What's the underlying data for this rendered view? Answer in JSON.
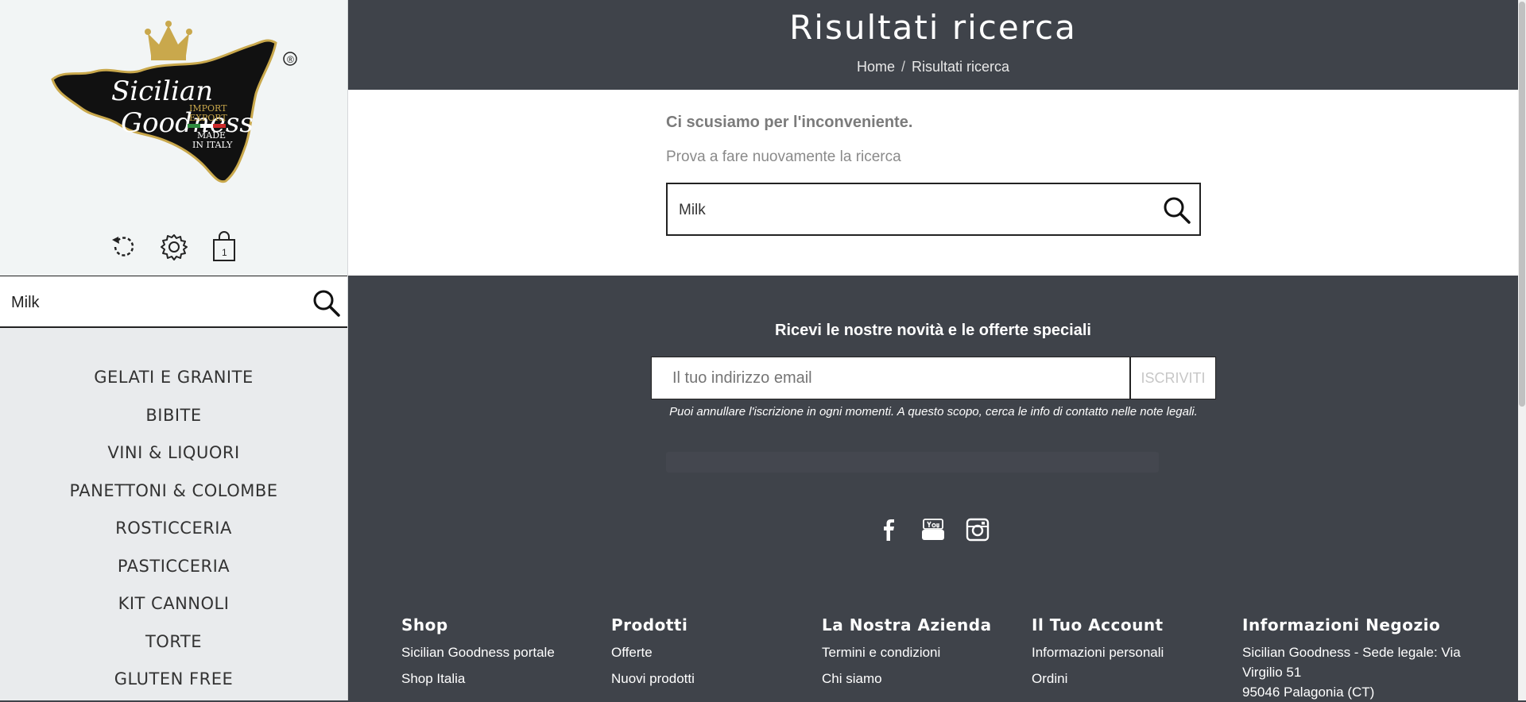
{
  "brand": {
    "logo_main_line1": "Sicilian",
    "logo_main_line2": "Goodness",
    "logo_tag1": "IMPORT",
    "logo_tag2": "EXPORT",
    "logo_tag3": "MADE",
    "logo_tag4": "IN ITALY",
    "registered": "®"
  },
  "sidebar": {
    "icons": [
      "history-icon",
      "gear-icon",
      "shopping-bag-icon"
    ],
    "cart_count": "1",
    "search_value": "Milk",
    "categories": [
      {
        "label": "GELATI E GRANITE"
      },
      {
        "label": "BIBITE"
      },
      {
        "label": "VINI & LIQUORI"
      },
      {
        "label": "PANETTONI & COLOMBE"
      },
      {
        "label": "ROSTICCERIA"
      },
      {
        "label": "PASTICCERIA"
      },
      {
        "label": "KIT CANNOLI"
      },
      {
        "label": "TORTE"
      },
      {
        "label": "GLUTEN FREE"
      }
    ]
  },
  "header": {
    "title": "Risultati ricerca",
    "breadcrumb": [
      "Home",
      "Risultati ricerca"
    ],
    "breadcrumb_separator": "/"
  },
  "main": {
    "sorry": "Ci scusiamo per l'inconveniente.",
    "retry": "Prova a fare nuovamente la ricerca",
    "search_value": "Milk"
  },
  "newsletter": {
    "title": "Ricevi le nostre novità e le offerte speciali",
    "email_placeholder": "Il tuo indirizzo email",
    "subscribe_label": "ISCRIVITI",
    "note": "Puoi annullare l'iscrizione in ogni momenti. A questo scopo, cerca le info di contatto nelle note legali."
  },
  "social": [
    "facebook-icon",
    "youtube-icon",
    "instagram-icon"
  ],
  "footer_columns": [
    {
      "title": "Shop",
      "links": [
        "Sicilian Goodness portale",
        "Shop Italia"
      ]
    },
    {
      "title": "Prodotti",
      "links": [
        "Offerte",
        "Nuovi prodotti"
      ]
    },
    {
      "title": "La Nostra Azienda",
      "links": [
        "Termini e condizioni",
        "Chi siamo"
      ]
    },
    {
      "title": "Il Tuo Account",
      "links": [
        "Informazioni personali",
        "Ordini"
      ]
    }
  ],
  "store_info": {
    "title": "Informazioni Negozio",
    "line1": "Sicilian Goodness - Sede legale: Via",
    "line2": "Virgilio 51",
    "line3": "95046 Palagonia (CT)"
  },
  "colors": {
    "dark": "#3f434a",
    "sidebar": "#e9ebed",
    "logo_gold": "#c9a84c",
    "logo_black": "#111111"
  }
}
